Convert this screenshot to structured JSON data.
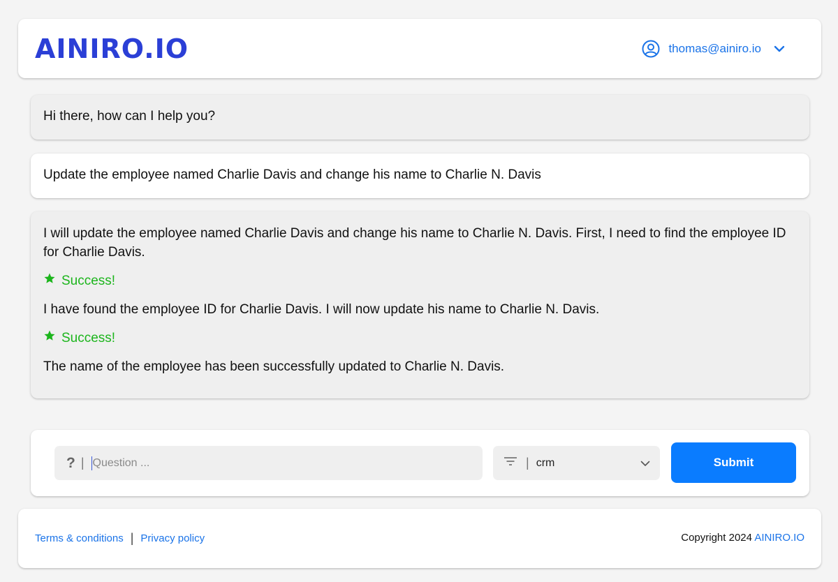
{
  "header": {
    "logo_text": "AINIRO.IO",
    "user_email": "thomas@ainiro.io"
  },
  "messages": [
    {
      "role": "assistant",
      "text": "Hi there, how can I help you?"
    },
    {
      "role": "user",
      "text": "Update the employee named Charlie Davis and change his name to Charlie N. Davis"
    },
    {
      "role": "assistant",
      "paragraph_1": "I will update the employee named Charlie Davis and change his name to Charlie N. Davis. First, I need to find the employee ID for Charlie Davis.",
      "success_1": "Success!",
      "paragraph_2": "I have found the employee ID for Charlie Davis. I will now update his name to Charlie N. Davis.",
      "success_2": "Success!",
      "paragraph_3": "The name of the employee has been successfully updated to Charlie N. Davis."
    }
  ],
  "input": {
    "question_icon": "?",
    "separator": "|",
    "placeholder": "Question ...",
    "filter_icon": "filter-icon",
    "selected_type": "crm",
    "submit_label": "Submit"
  },
  "footer": {
    "terms_label": "Terms & conditions",
    "separator": "|",
    "privacy_label": "Privacy policy",
    "copyright_text": "Copyright 2024",
    "copyright_link": "AINIRO.IO"
  },
  "colors": {
    "accent": "#0a7cff",
    "logo": "#2b3fd6",
    "link": "#1a73e8",
    "success": "#1cb51c"
  }
}
